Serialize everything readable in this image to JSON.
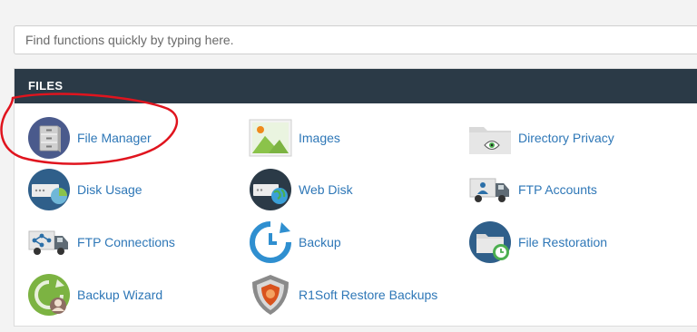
{
  "search": {
    "placeholder": "Find functions quickly by typing here."
  },
  "files_panel": {
    "title": "FILES",
    "items": [
      {
        "label": "File Manager",
        "icon": "file-cabinet-icon"
      },
      {
        "label": "Images",
        "icon": "image-icon"
      },
      {
        "label": "Directory Privacy",
        "icon": "folder-eye-icon"
      },
      {
        "label": "Disk Usage",
        "icon": "disk-usage-icon"
      },
      {
        "label": "Web Disk",
        "icon": "web-disk-icon"
      },
      {
        "label": "FTP Accounts",
        "icon": "ftp-accounts-icon"
      },
      {
        "label": "FTP Connections",
        "icon": "ftp-connections-icon"
      },
      {
        "label": "Backup",
        "icon": "backup-clock-icon"
      },
      {
        "label": "File Restoration",
        "icon": "file-restoration-icon"
      },
      {
        "label": "Backup Wizard",
        "icon": "backup-wizard-icon"
      },
      {
        "label": "R1Soft Restore Backups",
        "icon": "r1soft-shield-icon"
      }
    ]
  },
  "colors": {
    "header_bg": "#2b3a47",
    "link": "#2e77b7",
    "annotation": "#e0141e"
  }
}
